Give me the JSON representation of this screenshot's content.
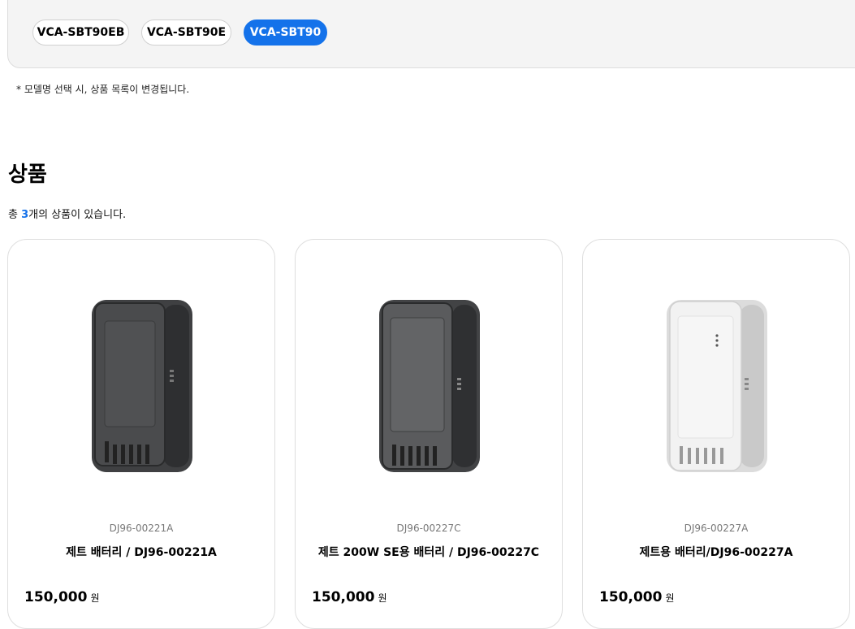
{
  "filters": {
    "chips": [
      {
        "label": "VCA-SBT90EB",
        "selected": false
      },
      {
        "label": "VCA-SBT90E",
        "selected": false
      },
      {
        "label": "VCA-SBT90",
        "selected": true
      }
    ],
    "note": "* 모델명 선택 시, 상품 목록이 변경됩니다."
  },
  "section": {
    "title": "상품",
    "count_prefix": "총 ",
    "count": "3",
    "count_suffix": "개의 상품이 있습니다."
  },
  "products": [
    {
      "sku": "DJ96-00221A",
      "name": "제트 배터리 / DJ96-00221A",
      "price": "150,000",
      "currency": "원",
      "color": "dark-gray"
    },
    {
      "sku": "DJ96-00227C",
      "name": "제트 200W SE용 배터리 / DJ96-00227C",
      "price": "150,000",
      "currency": "원",
      "color": "dark-gray"
    },
    {
      "sku": "DJ96-00227A",
      "name": "제트용 배터리/DJ96-00227A",
      "price": "150,000",
      "currency": "원",
      "color": "white"
    }
  ],
  "colors": {
    "accent": "#1472ea",
    "dark_battery": "#3f4042",
    "light_battery": "#eeeeee"
  }
}
